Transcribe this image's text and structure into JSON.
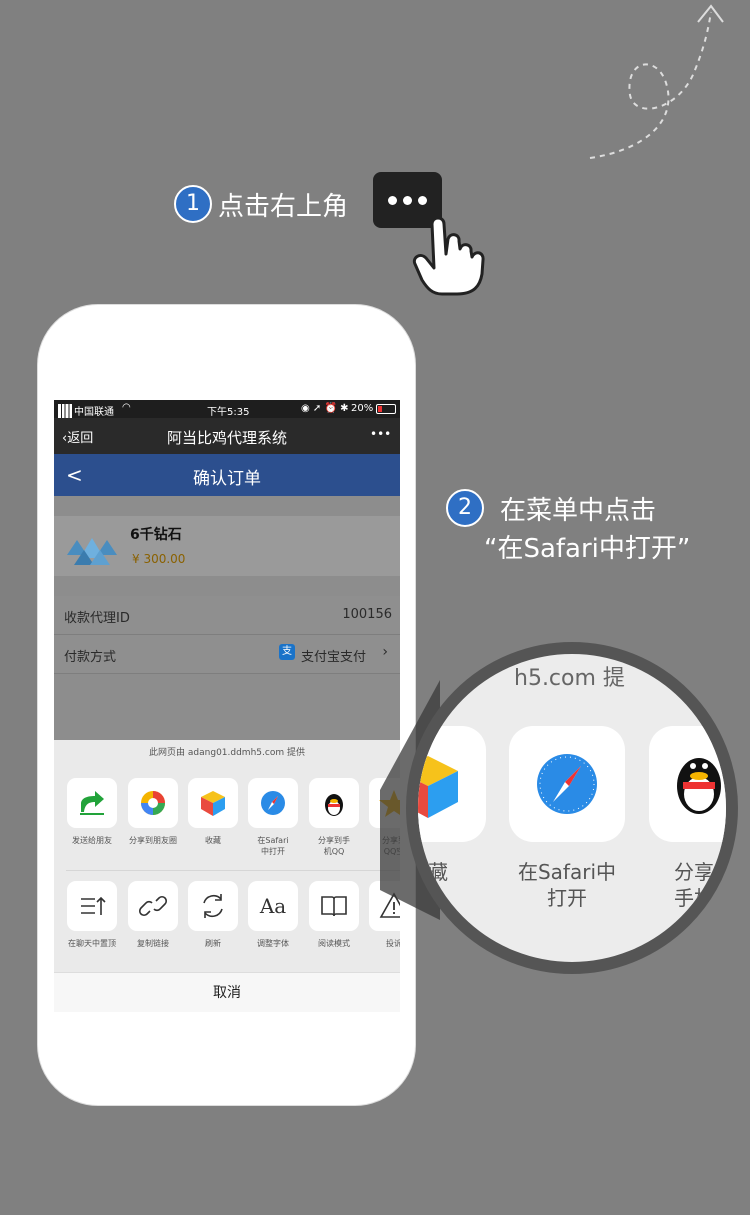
{
  "step1": {
    "num": "1",
    "text": "点击右上角"
  },
  "step2": {
    "num": "2",
    "line1": "在菜单中点击",
    "line2": "“在Safari中打开”"
  },
  "status": {
    "carrier": "中国联通",
    "time": "下午5:35",
    "battery": "20%"
  },
  "nav": {
    "back": "返回",
    "title": "阿当比鸡代理系统",
    "more": "•••"
  },
  "page": {
    "title": "确认订单",
    "back": "<"
  },
  "product": {
    "name": "6千钻石",
    "price": "¥ 300.00"
  },
  "rows": [
    {
      "label": "收款代理ID",
      "value": "100156"
    },
    {
      "label": "付款方式",
      "value": "支付宝支付"
    }
  ],
  "sheet": {
    "provider": "此网页由 adang01.ddmh5.com 提供",
    "row1": [
      {
        "icon": "share-arrow-icon",
        "label": "发送给朋友"
      },
      {
        "icon": "moments-icon",
        "label": "分享到朋友圈"
      },
      {
        "icon": "favorite-cube-icon",
        "label": "收藏"
      },
      {
        "icon": "safari-icon",
        "label": "在Safari中打开"
      },
      {
        "icon": "qq-icon",
        "label": "分享到手机QQ"
      },
      {
        "icon": "qzone-icon",
        "label": "分享到QQ空"
      }
    ],
    "row2": [
      {
        "icon": "pin-top-icon",
        "label": "在聊天中置顶"
      },
      {
        "icon": "link-icon",
        "label": "复制链接"
      },
      {
        "icon": "refresh-icon",
        "label": "刷新"
      },
      {
        "icon": "font-icon",
        "label": "调整字体"
      },
      {
        "icon": "reader-icon",
        "label": "阅读模式"
      },
      {
        "icon": "warning-icon",
        "label": "投诉"
      }
    ],
    "cancel": "取消"
  },
  "magnifier": {
    "top_text": "h5.com 提",
    "left_label": "藏",
    "safari_line1": "在Safari中",
    "safari_line2": "打开",
    "right_line1": "分享",
    "right_line2": "手机"
  },
  "colors": {
    "accent": "#2f6fc4",
    "page_header": "#2c4f8e",
    "price": "#b07a00"
  }
}
